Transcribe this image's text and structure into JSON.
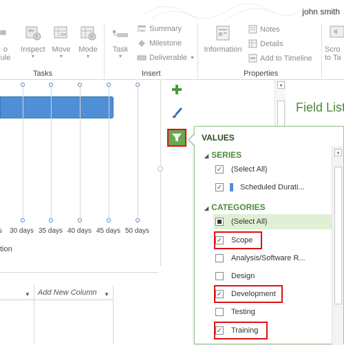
{
  "titlebar": {
    "username": "john smith"
  },
  "ribbon": {
    "groups": {
      "tasks": "Tasks",
      "insert": "Insert",
      "properties": "Properties"
    },
    "buttons": {
      "schedule_partial_top": "o",
      "schedule_partial_bottom": "ule",
      "inspect": "Inspect",
      "move": "Move",
      "mode": "Mode",
      "task": "Task",
      "summary": "Summary",
      "milestone": "Milestone",
      "deliverable": "Deliverable",
      "information": "Information",
      "notes": "Notes",
      "details": "Details",
      "add_to_timeline": "Add to Timeline",
      "scroll_to_task_top": "Scro",
      "scroll_to_task_bottom": "to Ta"
    }
  },
  "chart": {
    "tick_labels": [
      "s",
      "30 days",
      "35 days",
      "40 days",
      "45 days",
      "50 days"
    ],
    "axis_label": "tion"
  },
  "field_list": {
    "title": "Field List"
  },
  "table": {
    "add_new_column": "Add New Column"
  },
  "filter_popup": {
    "title": "VALUES",
    "series_heading": "SERIES",
    "categories_heading": "CATEGORIES",
    "series_items": [
      {
        "label": "(Select All)",
        "checked": true
      },
      {
        "label": "Scheduled Durati...",
        "checked": true
      }
    ],
    "category_items": [
      {
        "label": "(Select All)",
        "state": "indeterminate"
      },
      {
        "label": "Scope",
        "checked": true
      },
      {
        "label": "Analysis/Software R...",
        "checked": false
      },
      {
        "label": "Design",
        "checked": false
      },
      {
        "label": "Development",
        "checked": true
      },
      {
        "label": "Testing",
        "checked": false
      },
      {
        "label": "Training",
        "checked": true
      }
    ]
  },
  "colors": {
    "accent_green": "#6aa84f",
    "highlight_red": "#dd1111",
    "bar_blue": "#4f8fd6"
  }
}
